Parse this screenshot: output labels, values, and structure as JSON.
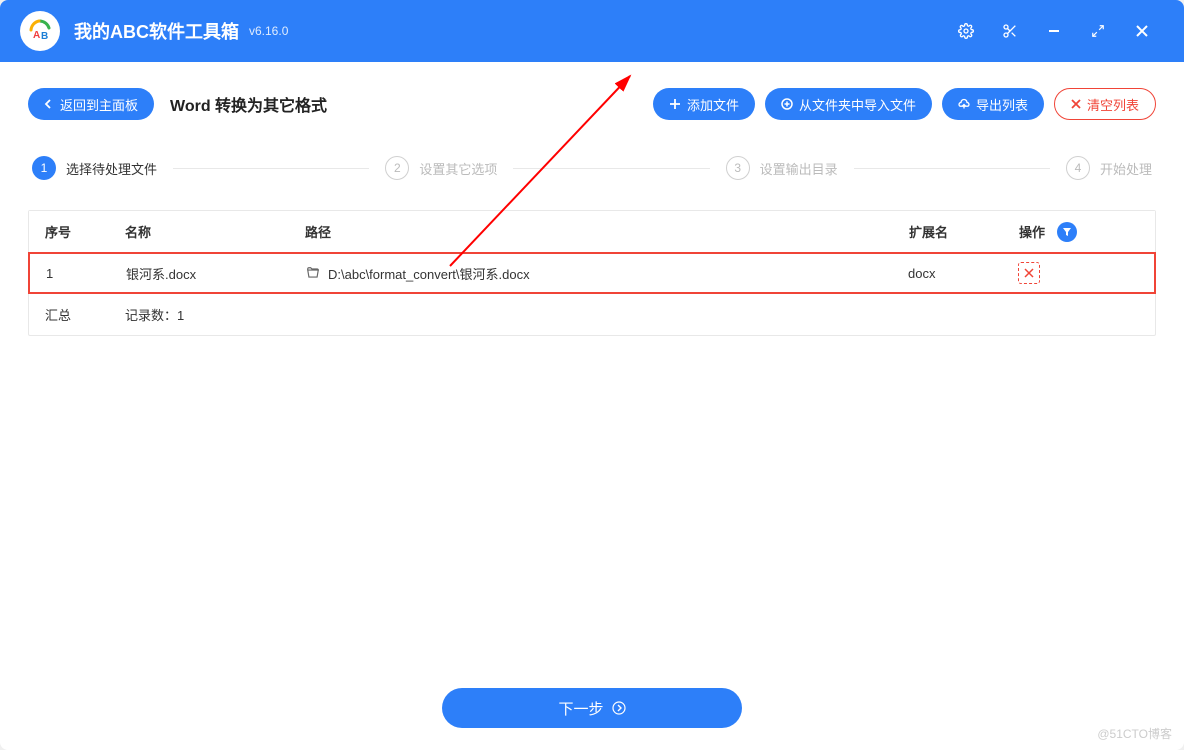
{
  "titlebar": {
    "app_name": "我的ABC软件工具箱",
    "version": "v6.16.0"
  },
  "header": {
    "back_label": "返回到主面板",
    "page_title": "Word 转换为其它格式",
    "add_file_label": "添加文件",
    "import_folder_label": "从文件夹中导入文件",
    "export_list_label": "导出列表",
    "clear_list_label": "清空列表"
  },
  "steps": {
    "s1": {
      "num": "1",
      "label": "选择待处理文件"
    },
    "s2": {
      "num": "2",
      "label": "设置其它选项"
    },
    "s3": {
      "num": "3",
      "label": "设置输出目录"
    },
    "s4": {
      "num": "4",
      "label": "开始处理"
    }
  },
  "table": {
    "headers": {
      "seq": "序号",
      "name": "名称",
      "path": "路径",
      "ext": "扩展名",
      "action": "操作"
    },
    "rows": [
      {
        "seq": "1",
        "name": "银河系.docx",
        "path": "D:\\abc\\format_convert\\银河系.docx",
        "ext": "docx"
      }
    ],
    "summary": {
      "label": "汇总",
      "count_label": "记录数：1"
    }
  },
  "footer": {
    "next_label": "下一步"
  },
  "watermark": "@51CTO博客"
}
